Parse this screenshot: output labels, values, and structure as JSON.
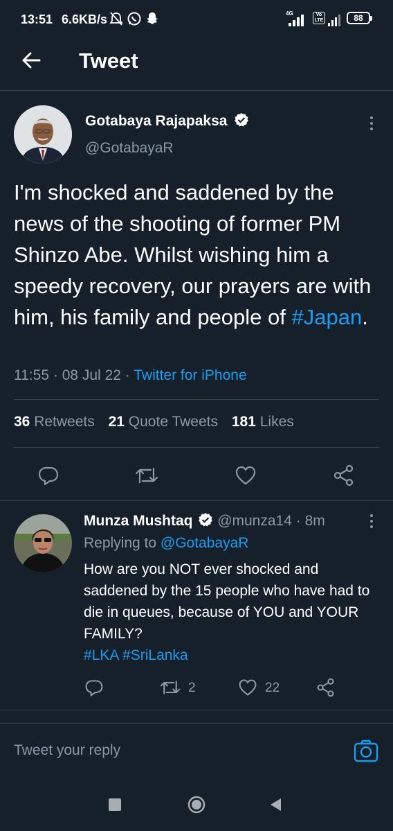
{
  "status_bar": {
    "time": "13:51",
    "speed": "6.6KB/s",
    "network_1": "4G",
    "network_2": "Vo LTE",
    "battery": "88",
    "icons": [
      "mute-icon",
      "whatsapp-icon",
      "snapchat-icon",
      "signal-icon",
      "battery-icon"
    ]
  },
  "header": {
    "title": "Tweet",
    "back_icon": "arrow-left-icon"
  },
  "tweet": {
    "author_name": "Gotabaya Rajapaksa",
    "author_handle": "@GotabayaR",
    "verified": true,
    "text_before": "I'm shocked and saddened by the news of the shooting of former PM Shinzo Abe. Whilst wishing him a speedy recovery, our prayers are with him, his family and people of ",
    "hashtag": "#Japan",
    "text_after": ".",
    "time": "11:55",
    "date": "08 Jul 22",
    "separator": "·",
    "source": "Twitter for iPhone",
    "stats": {
      "retweets_count": "36",
      "retweets_label": "Retweets",
      "quotes_count": "21",
      "quotes_label": "Quote Tweets",
      "likes_count": "181",
      "likes_label": "Likes"
    }
  },
  "reply": {
    "author_name": "Munza Mushtaq",
    "author_handle": "@munza14",
    "separator": "·",
    "time": "8m",
    "verified": true,
    "replying_to_label": "Replying to",
    "replying_to_handle": "@GotabayaR",
    "text": "How are you NOT ever shocked and saddened by the 15 people who have had to die in queues, because of YOU and YOUR FAMILY?",
    "hashtags": "#LKA #SriLanka",
    "retweet_count": "2",
    "like_count": "22"
  },
  "composer": {
    "placeholder": "Tweet your reply",
    "camera_icon": "camera-icon"
  },
  "colors": {
    "background": "#15202b",
    "link": "#1d9bf0",
    "muted": "#8b98a5",
    "divider": "#38444d"
  }
}
